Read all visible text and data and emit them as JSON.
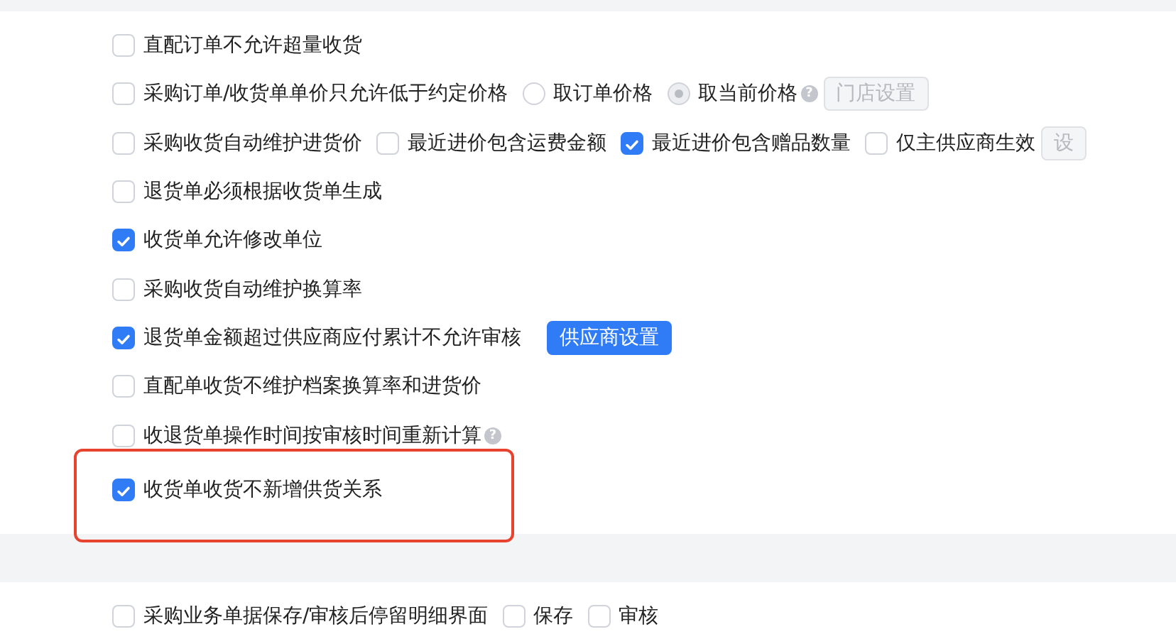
{
  "sections": [
    {
      "rows": [
        {
          "highlighted": false,
          "controls": [
            {
              "kind": "checkbox",
              "label": "直配订单不允许超量收货",
              "checked": false
            }
          ]
        },
        {
          "highlighted": false,
          "controls": [
            {
              "kind": "checkbox",
              "label": "采购订单/收货单单价只允许低于约定价格",
              "checked": false
            },
            {
              "kind": "radio",
              "label": "取订单价格",
              "selected": false
            },
            {
              "kind": "radio",
              "label": "取当前价格",
              "selected": true
            },
            {
              "kind": "help",
              "label": "?"
            },
            {
              "kind": "button",
              "label": "门店设置",
              "disabled": true
            }
          ]
        },
        {
          "highlighted": false,
          "controls": [
            {
              "kind": "checkbox",
              "label": "采购收货自动维护进货价",
              "checked": false
            },
            {
              "kind": "checkbox",
              "label": "最近进价包含运费金额",
              "checked": false
            },
            {
              "kind": "checkbox",
              "label": "最近进价包含赠品数量",
              "checked": true
            },
            {
              "kind": "checkbox",
              "label": "仅主供应商生效",
              "checked": false
            },
            {
              "kind": "button",
              "label": "设",
              "disabled": true
            }
          ]
        },
        {
          "highlighted": false,
          "controls": [
            {
              "kind": "checkbox",
              "label": "退货单必须根据收货单生成",
              "checked": false
            }
          ]
        },
        {
          "highlighted": false,
          "controls": [
            {
              "kind": "checkbox",
              "label": "收货单允许修改单位",
              "checked": true
            }
          ]
        },
        {
          "highlighted": false,
          "controls": [
            {
              "kind": "checkbox",
              "label": "采购收货自动维护换算率",
              "checked": false
            }
          ]
        },
        {
          "highlighted": false,
          "controls": [
            {
              "kind": "checkbox",
              "label": "退货单金额超过供应商应付累计不允许审核",
              "checked": true
            },
            {
              "kind": "button",
              "label": "供应商设置",
              "disabled": false
            }
          ]
        },
        {
          "highlighted": false,
          "controls": [
            {
              "kind": "checkbox",
              "label": "直配单收货不维护档案换算率和进货价",
              "checked": false
            }
          ]
        },
        {
          "highlighted": false,
          "controls": [
            {
              "kind": "checkbox",
              "label": "收退货单操作时间按审核时间重新计算",
              "checked": false
            },
            {
              "kind": "help",
              "label": "?"
            }
          ]
        },
        {
          "highlighted": true,
          "controls": [
            {
              "kind": "checkbox",
              "label": "收货单收货不新增供货关系",
              "checked": true
            }
          ]
        }
      ]
    },
    {
      "rows": [
        {
          "highlighted": false,
          "controls": [
            {
              "kind": "checkbox",
              "label": "采购业务单据保存/审核后停留明细界面",
              "checked": false
            },
            {
              "kind": "checkbox",
              "label": "保存",
              "checked": false
            },
            {
              "kind": "checkbox",
              "label": "审核",
              "checked": false
            }
          ]
        }
      ]
    }
  ]
}
